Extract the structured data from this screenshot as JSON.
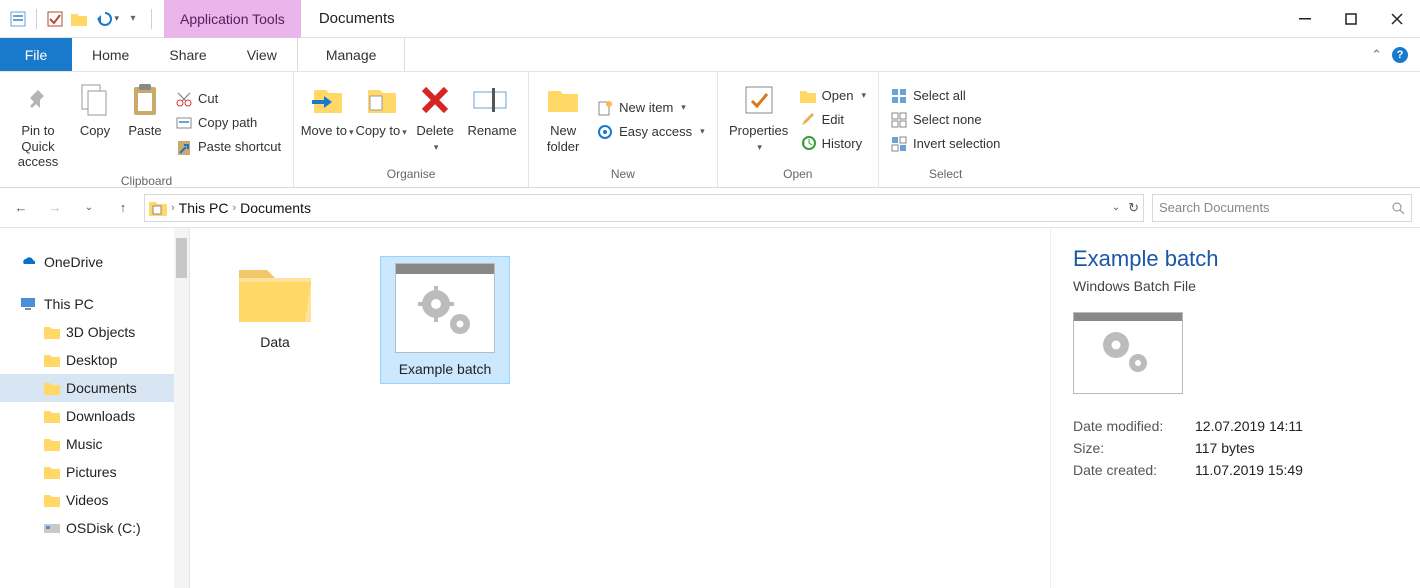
{
  "title": {
    "context_tab": "Application Tools",
    "window": "Documents"
  },
  "menubar": {
    "file": "File",
    "tabs": [
      "Home",
      "Share",
      "View"
    ],
    "context": "Manage"
  },
  "ribbon": {
    "clipboard": {
      "pin": "Pin to Quick access",
      "copy": "Copy",
      "paste": "Paste",
      "cut": "Cut",
      "copy_path": "Copy path",
      "paste_shortcut": "Paste shortcut",
      "label": "Clipboard"
    },
    "organise": {
      "move": "Move to",
      "copy": "Copy to",
      "delete": "Delete",
      "rename": "Rename",
      "label": "Organise"
    },
    "new": {
      "new_folder": "New folder",
      "new_item": "New item",
      "easy_access": "Easy access",
      "label": "New"
    },
    "open": {
      "properties": "Properties",
      "open": "Open",
      "edit": "Edit",
      "history": "History",
      "label": "Open"
    },
    "select": {
      "select_all": "Select all",
      "select_none": "Select none",
      "invert": "Invert selection",
      "label": "Select"
    }
  },
  "breadcrumbs": [
    "This PC",
    "Documents"
  ],
  "search_placeholder": "Search Documents",
  "tree": {
    "onedrive": "OneDrive",
    "this_pc": "This PC",
    "children": [
      "3D Objects",
      "Desktop",
      "Documents",
      "Downloads",
      "Music",
      "Pictures",
      "Videos",
      "OSDisk (C:)"
    ]
  },
  "items": [
    {
      "name": "Data",
      "type": "folder",
      "selected": false
    },
    {
      "name": "Example batch",
      "type": "batch",
      "selected": true
    }
  ],
  "details": {
    "title": "Example batch",
    "type": "Windows Batch File",
    "rows": [
      {
        "key": "Date modified:",
        "val": "12.07.2019 14:11"
      },
      {
        "key": "Size:",
        "val": "117 bytes"
      },
      {
        "key": "Date created:",
        "val": "11.07.2019 15:49"
      }
    ]
  }
}
